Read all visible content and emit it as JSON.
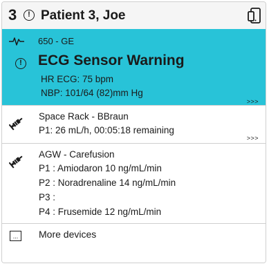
{
  "header": {
    "bed_number": "3",
    "alert_glyph": "!",
    "patient_name": "Patient 3, Joe",
    "device_icon": "phone-device-icon"
  },
  "alarm": {
    "device_label": "650 - GE",
    "alert_glyph": "!",
    "title": "ECG Sensor Warning",
    "line1": "HR ECG: 75 bpm",
    "line2": "NBP: 101/64 (82)mm Hg",
    "more": ">>>",
    "color": "#28c3d8",
    "icon": "ecg-wave-icon"
  },
  "devices": [
    {
      "name": "Space Rack - BBraun",
      "lines": [
        "P1: 26 mL/h, 00:05:18 remaining"
      ],
      "more": ">>>",
      "icon": "syringe-icon"
    },
    {
      "name": "AGW - Carefusion",
      "lines": [
        "P1 : Amiodaron 10 ng/mL/min",
        "P2 : Noradrenaline 14 ng/mL/min",
        "P3 :",
        "P4 : Frusemide 12 ng/mL/min"
      ],
      "icon": "syringe-icon"
    }
  ],
  "more_devices": {
    "glyph": "...",
    "label": "More devices"
  }
}
